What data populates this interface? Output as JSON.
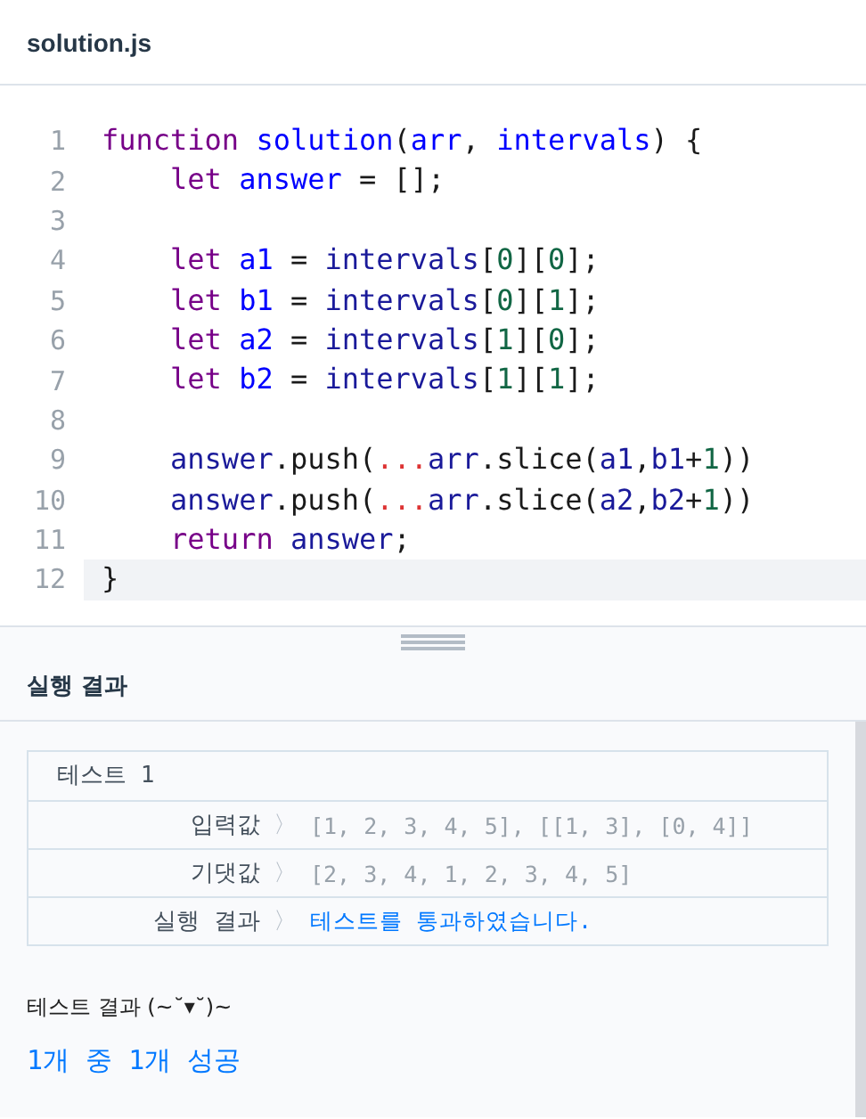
{
  "file_tab": {
    "title": "solution.js"
  },
  "code_lines": [
    {
      "number": "1",
      "current": false,
      "indented": false,
      "tokens": [
        {
          "kind": "keyword",
          "text": "function "
        },
        {
          "kind": "def",
          "text": "solution"
        },
        {
          "kind": "plain",
          "text": "("
        },
        {
          "kind": "def",
          "text": "arr"
        },
        {
          "kind": "plain",
          "text": ", "
        },
        {
          "kind": "def",
          "text": "intervals"
        },
        {
          "kind": "plain",
          "text": ") {"
        }
      ]
    },
    {
      "number": "2",
      "current": false,
      "indented": true,
      "tokens": [
        {
          "kind": "keyword",
          "text": "let "
        },
        {
          "kind": "def",
          "text": "answer"
        },
        {
          "kind": "plain",
          "text": " = [];"
        }
      ]
    },
    {
      "number": "3"
    },
    {
      "number": "4",
      "current": false,
      "indented": true,
      "tokens": [
        {
          "kind": "keyword",
          "text": "let "
        },
        {
          "kind": "def",
          "text": "a1"
        },
        {
          "kind": "plain",
          "text": " = "
        },
        {
          "kind": "var",
          "text": "intervals"
        },
        {
          "kind": "plain",
          "text": "["
        },
        {
          "kind": "number",
          "text": "0"
        },
        {
          "kind": "plain",
          "text": "]["
        },
        {
          "kind": "number",
          "text": "0"
        },
        {
          "kind": "plain",
          "text": "];"
        }
      ]
    },
    {
      "number": "5",
      "current": false,
      "indented": true,
      "tokens": [
        {
          "kind": "keyword",
          "text": "let "
        },
        {
          "kind": "def",
          "text": "b1"
        },
        {
          "kind": "plain",
          "text": " = "
        },
        {
          "kind": "var",
          "text": "intervals"
        },
        {
          "kind": "plain",
          "text": "["
        },
        {
          "kind": "number",
          "text": "0"
        },
        {
          "kind": "plain",
          "text": "]["
        },
        {
          "kind": "number",
          "text": "1"
        },
        {
          "kind": "plain",
          "text": "];"
        }
      ]
    },
    {
      "number": "6",
      "current": false,
      "indented": true,
      "tokens": [
        {
          "kind": "keyword",
          "text": "let "
        },
        {
          "kind": "def",
          "text": "a2"
        },
        {
          "kind": "plain",
          "text": " = "
        },
        {
          "kind": "var",
          "text": "intervals"
        },
        {
          "kind": "plain",
          "text": "["
        },
        {
          "kind": "number",
          "text": "1"
        },
        {
          "kind": "plain",
          "text": "]["
        },
        {
          "kind": "number",
          "text": "0"
        },
        {
          "kind": "plain",
          "text": "];"
        }
      ]
    },
    {
      "number": "7",
      "current": false,
      "indented": true,
      "tokens": [
        {
          "kind": "keyword",
          "text": "let "
        },
        {
          "kind": "def",
          "text": "b2"
        },
        {
          "kind": "plain",
          "text": " = "
        },
        {
          "kind": "var",
          "text": "intervals"
        },
        {
          "kind": "plain",
          "text": "["
        },
        {
          "kind": "number",
          "text": "1"
        },
        {
          "kind": "plain",
          "text": "]["
        },
        {
          "kind": "number",
          "text": "1"
        },
        {
          "kind": "plain",
          "text": "];"
        }
      ]
    },
    {
      "number": "8"
    },
    {
      "number": "9",
      "current": false,
      "indented": true,
      "tokens": [
        {
          "kind": "var",
          "text": "answer"
        },
        {
          "kind": "plain",
          "text": ".push("
        },
        {
          "kind": "spread",
          "text": "..."
        },
        {
          "kind": "var",
          "text": "arr"
        },
        {
          "kind": "plain",
          "text": ".slice("
        },
        {
          "kind": "var",
          "text": "a1"
        },
        {
          "kind": "plain",
          "text": ","
        },
        {
          "kind": "var",
          "text": "b1"
        },
        {
          "kind": "plain",
          "text": "+"
        },
        {
          "kind": "number",
          "text": "1"
        },
        {
          "kind": "plain",
          "text": "))"
        }
      ]
    },
    {
      "number": "10",
      "current": false,
      "indented": true,
      "tokens": [
        {
          "kind": "var",
          "text": "answer"
        },
        {
          "kind": "plain",
          "text": ".push("
        },
        {
          "kind": "spread",
          "text": "..."
        },
        {
          "kind": "var",
          "text": "arr"
        },
        {
          "kind": "plain",
          "text": ".slice("
        },
        {
          "kind": "var",
          "text": "a2"
        },
        {
          "kind": "plain",
          "text": ","
        },
        {
          "kind": "var",
          "text": "b2"
        },
        {
          "kind": "plain",
          "text": "+"
        },
        {
          "kind": "number",
          "text": "1"
        },
        {
          "kind": "plain",
          "text": "))"
        }
      ]
    },
    {
      "number": "11",
      "current": false,
      "indented": true,
      "tokens": [
        {
          "kind": "keyword",
          "text": "return "
        },
        {
          "kind": "var",
          "text": "answer"
        },
        {
          "kind": "plain",
          "text": ";"
        }
      ]
    },
    {
      "number": "12",
      "current": true,
      "indented": false,
      "tokens": [
        {
          "kind": "plain",
          "text": "}"
        }
      ]
    }
  ],
  "results": {
    "title": "실행 결과",
    "test_case": {
      "title": "테스트 1",
      "rows": [
        {
          "label": "입력값",
          "arrow": "〉",
          "value": "[1, 2, 3, 4, 5], [[1, 3], [0, 4]]",
          "passed": false
        },
        {
          "label": "기댓값",
          "arrow": "〉",
          "value": "[2, 3, 4, 1, 2, 3, 4, 5]",
          "passed": false
        },
        {
          "label": "실행 결과",
          "arrow": "〉",
          "value": "테스트를 통과하였습니다.",
          "passed": true
        }
      ]
    },
    "summary_title": "테스트 결과 (~˘▾˘)~",
    "summary": "1개 중 1개 성공"
  }
}
